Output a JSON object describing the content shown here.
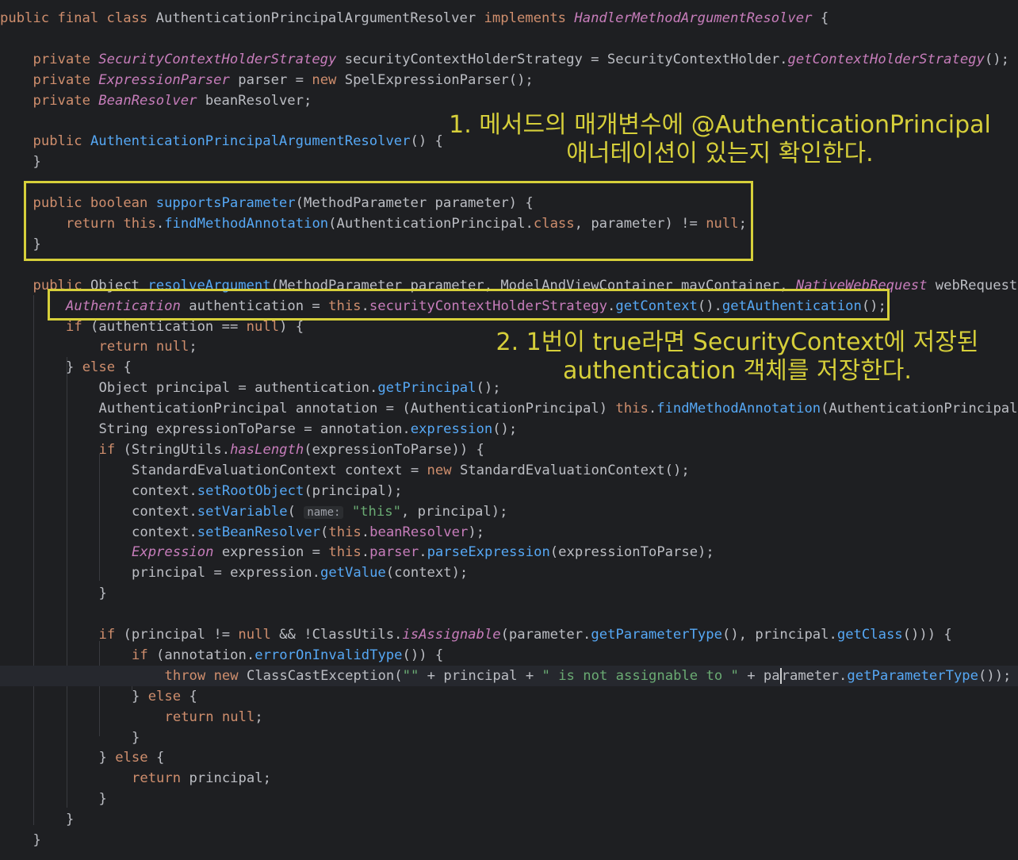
{
  "code_lines": [
    [
      [
        "kw",
        "public "
      ],
      [
        "kw",
        "final "
      ],
      [
        "kw",
        "class "
      ],
      [
        "ty",
        "AuthenticationPrincipalArgumentResolver "
      ],
      [
        "kw",
        "implements "
      ],
      [
        "it",
        "HandlerMethodArgumentResolver"
      ],
      [
        "ty",
        " {"
      ]
    ],
    [],
    [
      [
        "kw",
        "private "
      ],
      [
        "it",
        "SecurityContextHolderStrategy "
      ],
      [
        "ty",
        "securityContextHolderStrategy = "
      ],
      [
        "ty",
        "SecurityContextHolder."
      ],
      [
        "it",
        "getContextHolderStrategy"
      ],
      [
        "ty",
        "();"
      ]
    ],
    [
      [
        "kw",
        "private "
      ],
      [
        "it",
        "ExpressionParser "
      ],
      [
        "ty",
        "parser = "
      ],
      [
        "kw",
        "new "
      ],
      [
        "ty",
        "SpelExpressionParser();"
      ]
    ],
    [
      [
        "kw",
        "private "
      ],
      [
        "it",
        "BeanResolver "
      ],
      [
        "ty",
        "beanResolver;"
      ]
    ],
    [],
    [
      [
        "kw",
        "public "
      ],
      [
        "fn",
        "AuthenticationPrincipalArgumentResolver"
      ],
      [
        "ty",
        "() {"
      ]
    ],
    [
      [
        "ty",
        "}"
      ]
    ],
    [],
    [
      [
        "kw",
        "public boolean "
      ],
      [
        "fn",
        "supportsParameter"
      ],
      [
        "ty",
        "(MethodParameter parameter) {"
      ]
    ],
    [
      [
        "kw",
        "return "
      ],
      [
        "kw",
        "this"
      ],
      [
        "ty",
        "."
      ],
      [
        "fn",
        "findMethodAnnotation"
      ],
      [
        "ty",
        "(AuthenticationPrincipal."
      ],
      [
        "kw",
        "class"
      ],
      [
        "ty",
        ", parameter) != "
      ],
      [
        "kw",
        "null"
      ],
      [
        "ty",
        ";"
      ]
    ],
    [
      [
        "ty",
        "}"
      ]
    ],
    [],
    [
      [
        "kw",
        "public "
      ],
      [
        "ty",
        "Object "
      ],
      [
        "fn",
        "resolveArgument"
      ],
      [
        "ty",
        "(MethodParameter parameter, ModelAndViewContainer mavContainer, "
      ],
      [
        "it",
        "NativeWebRequest "
      ],
      [
        "ty",
        "webRequest"
      ]
    ],
    [
      [
        "it",
        "Authentication "
      ],
      [
        "ty",
        "authentication = "
      ],
      [
        "kw",
        "this"
      ],
      [
        "ty",
        "."
      ],
      [
        "fld",
        "securityContextHolderStrategy"
      ],
      [
        "ty",
        "."
      ],
      [
        "fn",
        "getContext"
      ],
      [
        "ty",
        "()."
      ],
      [
        "fn",
        "getAuthentication"
      ],
      [
        "ty",
        "();"
      ]
    ],
    [
      [
        "kw",
        "if "
      ],
      [
        "ty",
        "(authentication == "
      ],
      [
        "kw",
        "null"
      ],
      [
        "ty",
        ") {"
      ]
    ],
    [
      [
        "kw",
        "return null"
      ],
      [
        "ty",
        ";"
      ]
    ],
    [
      [
        "ty",
        "} "
      ],
      [
        "kw",
        "else "
      ],
      [
        "ty",
        "{"
      ]
    ],
    [
      [
        "ty",
        "Object principal = authentication."
      ],
      [
        "fn",
        "getPrincipal"
      ],
      [
        "ty",
        "();"
      ]
    ],
    [
      [
        "ty",
        "AuthenticationPrincipal annotation = (AuthenticationPrincipal) "
      ],
      [
        "kw",
        "this"
      ],
      [
        "ty",
        "."
      ],
      [
        "fn",
        "findMethodAnnotation"
      ],
      [
        "ty",
        "(AuthenticationPrincipal."
      ]
    ],
    [
      [
        "ty",
        "String expressionToParse = annotation."
      ],
      [
        "fn",
        "expression"
      ],
      [
        "ty",
        "();"
      ]
    ],
    [
      [
        "kw",
        "if "
      ],
      [
        "ty",
        "(StringUtils."
      ],
      [
        "it",
        "hasLength"
      ],
      [
        "ty",
        "(expressionToParse)) {"
      ]
    ],
    [
      [
        "ty",
        "StandardEvaluationContext context = "
      ],
      [
        "kw",
        "new "
      ],
      [
        "ty",
        "StandardEvaluationContext();"
      ]
    ],
    [
      [
        "ty",
        "context."
      ],
      [
        "fn",
        "setRootObject"
      ],
      [
        "ty",
        "(principal);"
      ]
    ],
    [
      [
        "ty",
        "context."
      ],
      [
        "fn",
        "setVariable"
      ],
      [
        "ty",
        "( "
      ],
      [
        "hint",
        "name:"
      ],
      [
        "str",
        " \"this\""
      ],
      [
        "ty",
        ", principal);"
      ]
    ],
    [
      [
        "ty",
        "context."
      ],
      [
        "fn",
        "setBeanResolver"
      ],
      [
        "ty",
        "("
      ],
      [
        "kw",
        "this"
      ],
      [
        "ty",
        "."
      ],
      [
        "fld",
        "beanResolver"
      ],
      [
        "ty",
        ");"
      ]
    ],
    [
      [
        "it",
        "Expression "
      ],
      [
        "ty",
        "expression = "
      ],
      [
        "kw",
        "this"
      ],
      [
        "ty",
        "."
      ],
      [
        "fld",
        "parser"
      ],
      [
        "ty",
        "."
      ],
      [
        "fn",
        "parseExpression"
      ],
      [
        "ty",
        "(expressionToParse);"
      ]
    ],
    [
      [
        "ty",
        "principal = expression."
      ],
      [
        "fn",
        "getValue"
      ],
      [
        "ty",
        "(context);"
      ]
    ],
    [
      [
        "ty",
        "}"
      ]
    ],
    [],
    [
      [
        "kw",
        "if "
      ],
      [
        "ty",
        "(principal != "
      ],
      [
        "kw",
        "null "
      ],
      [
        "ty",
        "&& !ClassUtils."
      ],
      [
        "it",
        "isAssignable"
      ],
      [
        "ty",
        "(parameter."
      ],
      [
        "fn",
        "getParameterType"
      ],
      [
        "ty",
        "(), principal."
      ],
      [
        "fn",
        "getClass"
      ],
      [
        "ty",
        "())) {"
      ]
    ],
    [
      [
        "kw",
        "if "
      ],
      [
        "ty",
        "(annotation."
      ],
      [
        "fn",
        "errorOnInvalidType"
      ],
      [
        "ty",
        "()) {"
      ]
    ],
    [
      [
        "kw",
        "throw new "
      ],
      [
        "ty",
        "ClassCastException("
      ],
      [
        "str",
        "\"\""
      ],
      [
        "ty",
        " + principal + "
      ],
      [
        "str",
        "\" is not assignable to \""
      ],
      [
        "ty",
        " + pa"
      ],
      [
        "caret",
        ""
      ],
      [
        "ty",
        "rameter."
      ],
      [
        "fn",
        "getParameterType"
      ],
      [
        "ty",
        "());"
      ]
    ],
    [
      [
        "ty",
        "} "
      ],
      [
        "kw",
        "else "
      ],
      [
        "ty",
        "{"
      ]
    ],
    [
      [
        "kw",
        "return null"
      ],
      [
        "ty",
        ";"
      ]
    ],
    [
      [
        "ty",
        "}"
      ]
    ],
    [
      [
        "ty",
        "} "
      ],
      [
        "kw",
        "else "
      ],
      [
        "ty",
        "{"
      ]
    ],
    [
      [
        "kw",
        "return "
      ],
      [
        "ty",
        "principal;"
      ]
    ],
    [
      [
        "ty",
        "}"
      ]
    ],
    [
      [
        "ty",
        "}"
      ]
    ],
    [
      [
        "ty",
        "}"
      ]
    ]
  ],
  "annotations": {
    "note1_line1": "1. 메서드의 매개변수에 @AuthenticationPrincipal",
    "note1_line2": "애너테이션이 있는지 확인한다.",
    "note2_line1": "2. 1번이 true라면 SecurityContext에 저장된",
    "note2_line2": "authentication 객체를 저장한다."
  },
  "colors": {
    "background": "#1e1f22",
    "highlight_box": "#d6cf3a",
    "keyword": "#cf8e6d",
    "method": "#56a8f5",
    "string": "#6aab73",
    "field": "#c77dbb"
  }
}
